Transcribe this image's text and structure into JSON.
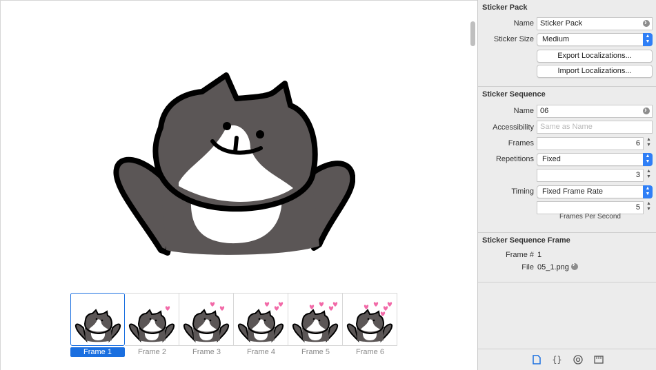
{
  "colors": {
    "accent": "#1a6fe0",
    "heart": "#f26aa8",
    "cat_body": "#5b5656"
  },
  "sticker_pack": {
    "title": "Sticker Pack",
    "name_label": "Name",
    "name_value": "Sticker Pack",
    "size_label": "Sticker Size",
    "size_value": "Medium",
    "export_button": "Export Localizations...",
    "import_button": "Import Localizations..."
  },
  "sticker_sequence": {
    "title": "Sticker Sequence",
    "name_label": "Name",
    "name_value": "06",
    "accessibility_label": "Accessibility",
    "accessibility_placeholder": "Same as Name",
    "frames_label": "Frames",
    "frames_value": "6",
    "repetitions_label": "Repetitions",
    "repetitions_value": "Fixed",
    "repetitions_count": "3",
    "timing_label": "Timing",
    "timing_value": "Fixed Frame Rate",
    "fps_value": "5",
    "fps_caption": "Frames Per Second"
  },
  "sticker_sequence_frame": {
    "title": "Sticker Sequence Frame",
    "frame_label": "Frame #",
    "frame_value": "1",
    "file_label": "File",
    "file_value": "05_1.png"
  },
  "frames": [
    {
      "label": "Frame 1",
      "hearts": 0,
      "selected": true
    },
    {
      "label": "Frame 2",
      "hearts": 1,
      "selected": false
    },
    {
      "label": "Frame 3",
      "hearts": 2,
      "selected": false
    },
    {
      "label": "Frame 4",
      "hearts": 3,
      "selected": false
    },
    {
      "label": "Frame 5",
      "hearts": 4,
      "selected": false
    },
    {
      "label": "Frame 6",
      "hearts": 5,
      "selected": false
    }
  ],
  "inspector_tabs": [
    {
      "icon": "file-icon",
      "active": true
    },
    {
      "icon": "braces-icon",
      "active": false
    },
    {
      "icon": "target-icon",
      "active": false
    },
    {
      "icon": "ruler-icon",
      "active": false
    }
  ]
}
